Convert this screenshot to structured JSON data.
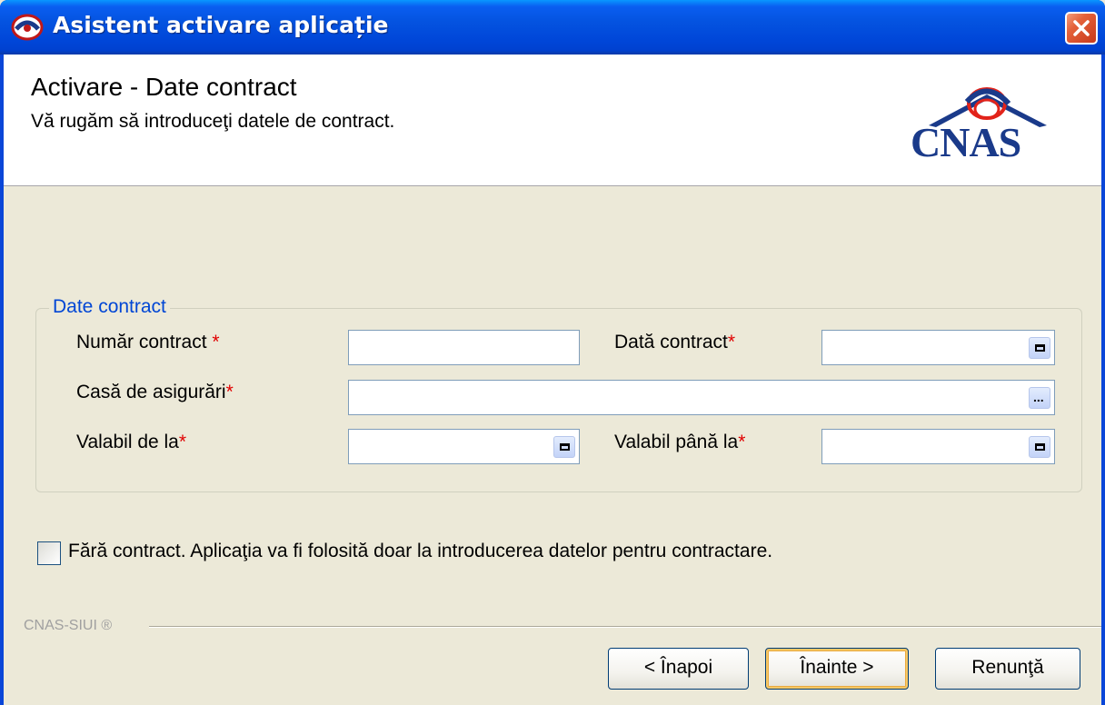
{
  "window": {
    "title": "Asistent activare aplicație",
    "close_label": "×"
  },
  "header": {
    "title": "Activare - Date contract",
    "subtitle": "Vă rugăm să introduceţi datele de contract.",
    "logo_text": "CNAS"
  },
  "group": {
    "legend": "Date contract",
    "required_marker": "*",
    "fields": {
      "contract_number": {
        "label": "Număr contract",
        "value": ""
      },
      "contract_date": {
        "label": "Dată contract",
        "value": ""
      },
      "insurance_house": {
        "label": "Casă de asigurări",
        "value": ""
      },
      "valid_from": {
        "label": "Valabil de la",
        "value": ""
      },
      "valid_until": {
        "label": "Valabil până la",
        "value": ""
      }
    },
    "browse_label": "..."
  },
  "no_contract": {
    "checked": false,
    "label": "Fără contract. Aplicaţia va fi folosită doar la introducerea datelor pentru contractare."
  },
  "footer": {
    "brand": "CNAS-SIUI ®",
    "back_label": "< Înapoi",
    "next_label": "Înainte >",
    "cancel_label": "Renunţă"
  },
  "colors": {
    "titlebar": "#0046d8",
    "legend": "#0046d5",
    "required": "#e00000",
    "logo": "#1a3a8a",
    "logo_swoosh": "#e2231a"
  }
}
